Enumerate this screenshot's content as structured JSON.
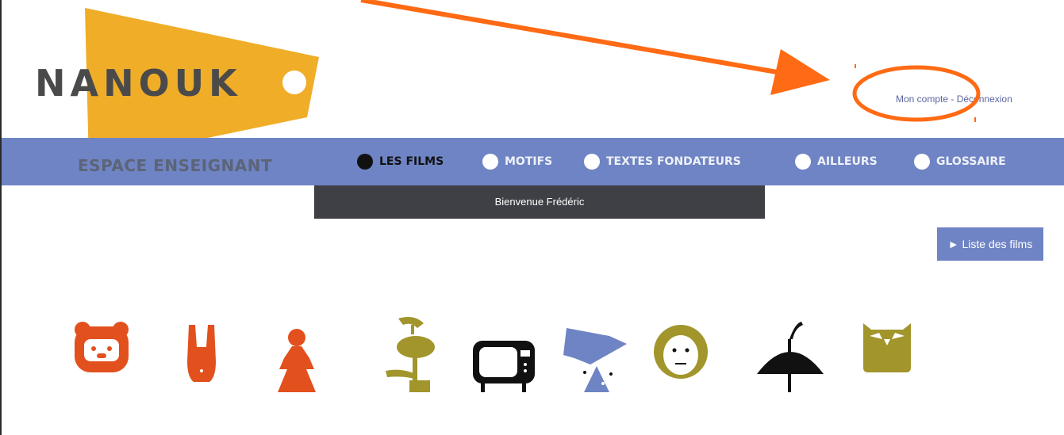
{
  "brand": {
    "logo_text": "NANOUK"
  },
  "header": {
    "account_link": "Mon compte",
    "separator": "-",
    "logout_link": "Déconnexion"
  },
  "nav": {
    "section_title": "ESPACE ENSEIGNANT",
    "items": [
      {
        "label": "LES FILMS",
        "active": true
      },
      {
        "label": "MOTIFS",
        "active": false
      },
      {
        "label": "TEXTES FONDATEURS",
        "active": false
      },
      {
        "label": "AILLEURS",
        "active": false
      },
      {
        "label": "GLOSSAIRE",
        "active": false
      }
    ]
  },
  "welcome": {
    "text": "Bienvenue Frédéric"
  },
  "films_button": {
    "label": "► Liste des films"
  },
  "colors": {
    "logo_yellow": "#f0ad28",
    "nav_blue": "#6f84c4",
    "welcome_bg": "#3e4045",
    "accent_orange": "#ff6a14",
    "icon_red": "#e2501e",
    "icon_olive": "#a2952b"
  },
  "icons": [
    "bear-face-icon",
    "rabbit-icon",
    "girl-icon",
    "plant-figure-icon",
    "television-icon",
    "blue-hat-figure-icon",
    "face-icon",
    "umbrella-icon",
    "owl-icon"
  ]
}
